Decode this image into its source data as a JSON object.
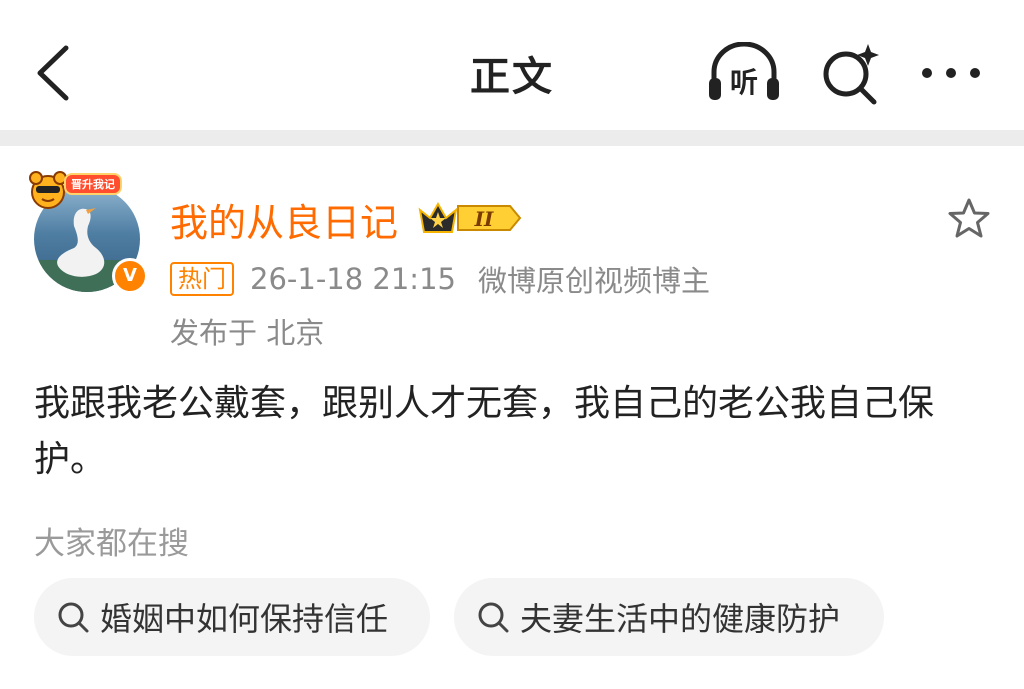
{
  "header": {
    "title": "正文",
    "listen_label": "听",
    "icons": [
      "back-arrow-icon",
      "headphones-listen-icon",
      "search-sparkle-icon",
      "more-dots-icon"
    ]
  },
  "post": {
    "author": {
      "name": "我的从良日记",
      "sticker_label": "晋升我记",
      "verified_mark": "V",
      "vip_level": "II"
    },
    "tag": "热门",
    "time": "26-1-18 21:15",
    "source": "微博原创视频博主",
    "location": "发布于 北京",
    "content": "我跟我老公戴套，跟别人才无套，我自己的老公我自己保护。"
  },
  "search": {
    "section_title": "大家都在搜",
    "chips": [
      {
        "label": "婚姻中如何保持信任"
      },
      {
        "label": "夫妻生活中的健康防护"
      }
    ]
  },
  "colors": {
    "accent": "#ff6b00",
    "tag": "#ff8200",
    "meta_text": "#8a8a8a",
    "chip_bg": "#f4f4f4",
    "divider": "#ececec"
  }
}
